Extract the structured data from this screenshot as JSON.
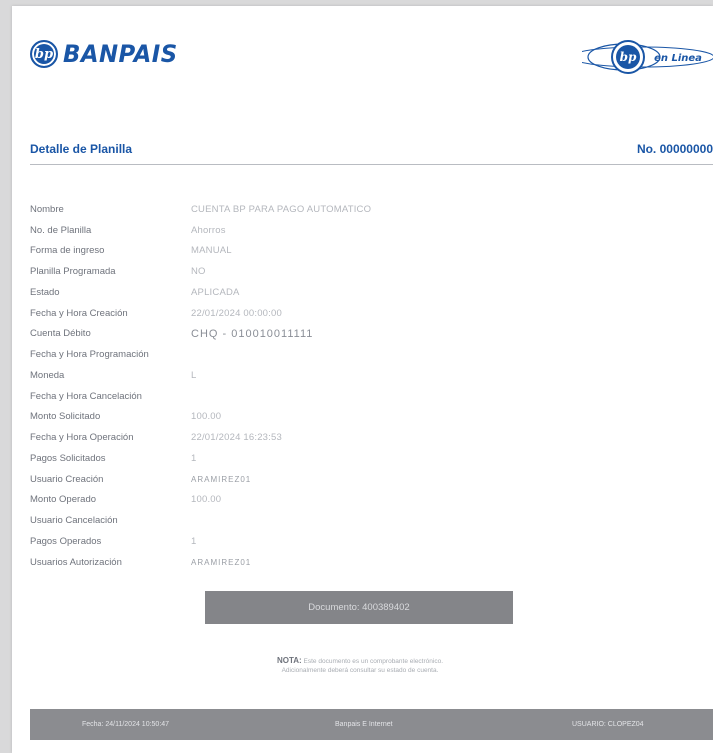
{
  "header": {
    "logo_monogram": "bp",
    "brand_name": "BANPAIS",
    "online_logo_monogram": "bp",
    "online_logo_text": "en Linea"
  },
  "section": {
    "title": "Detalle de Planilla",
    "number": "No. 00000000"
  },
  "fields": [
    {
      "label": "Nombre",
      "value": "CUENTA BP PARA PAGO AUTOMATICO"
    },
    {
      "label": "No. de Planilla",
      "value": "Ahorros"
    },
    {
      "label": "Forma de ingreso",
      "value": "MANUAL"
    },
    {
      "label": "Planilla Programada",
      "value": "NO"
    },
    {
      "label": "Estado",
      "value": "APLICADA"
    },
    {
      "label": "Fecha y Hora Creación",
      "value": "22/01/2024 00:00:00"
    },
    {
      "label": "Cuenta Débito",
      "value": "CHQ - 010010011111"
    },
    {
      "label": "Fecha y Hora Programación",
      "value": ""
    },
    {
      "label": "Moneda",
      "value": "L"
    },
    {
      "label": "Fecha y Hora Cancelación",
      "value": ""
    },
    {
      "label": "Monto Solicitado",
      "value": "100.00"
    },
    {
      "label": "Fecha y Hora Operación",
      "value": "22/01/2024 16:23:53"
    },
    {
      "label": "Pagos Solicitados",
      "value": "1"
    },
    {
      "label": "Usuario Creación",
      "value": "ARAMIREZ01"
    },
    {
      "label": "Monto Operado",
      "value": "100.00"
    },
    {
      "label": "Usuario Cancelación",
      "value": ""
    },
    {
      "label": "Pagos Operados",
      "value": "1"
    },
    {
      "label": "Usuarios Autorización",
      "value": "ARAMIREZ01"
    }
  ],
  "document_button": "Documento: 400389402",
  "note": {
    "label": "NOTA:",
    "line1": "Este documento es un comprobante electrónico.",
    "line2": "Adicionalmente deberá consultar su estado de cuenta."
  },
  "footer": {
    "date": "Fecha: 24/11/2024 10:50:47",
    "channel": "Banpais E Internet",
    "user": "USUARIO: CLOPEZ04"
  },
  "colors": {
    "brand_blue": "#1a56a6",
    "button_gray": "#848589",
    "footer_gray": "#8b8c90"
  }
}
